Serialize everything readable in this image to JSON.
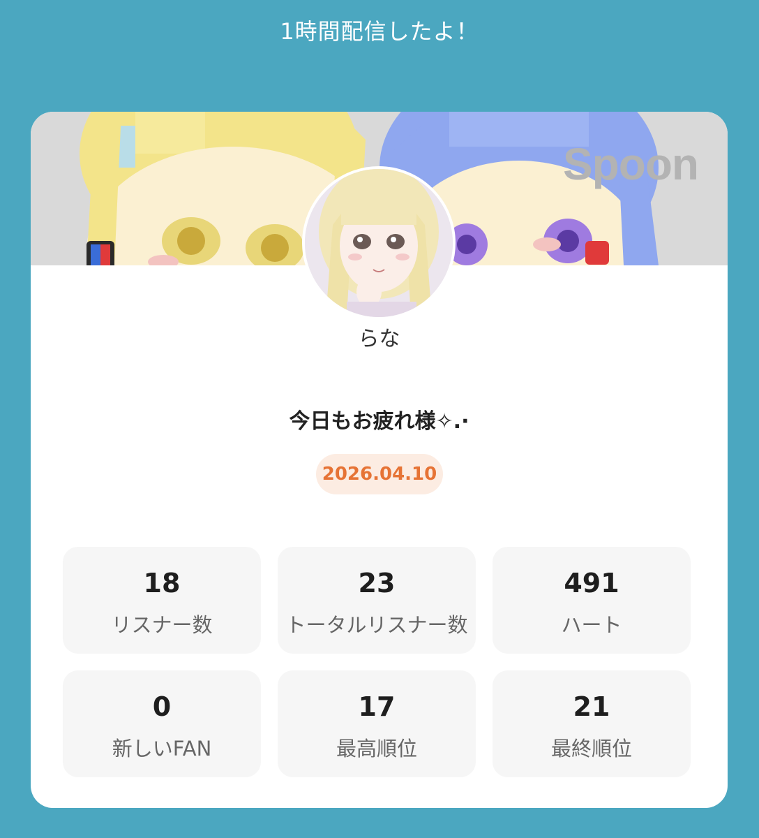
{
  "header": {
    "title": "1時間配信したよ！"
  },
  "card": {
    "banner": {
      "watermark": "Spoon"
    },
    "user": {
      "name": "らな",
      "avatar": "user-avatar"
    },
    "headline": "今日もお疲れ様✧.·",
    "date": "2026.04.10",
    "stats": [
      {
        "value": "18",
        "label": "リスナー数"
      },
      {
        "value": "23",
        "label": "トータルリスナー数"
      },
      {
        "value": "491",
        "label": "ハート"
      },
      {
        "value": "0",
        "label": "新しいFAN"
      },
      {
        "value": "17",
        "label": "最高順位"
      },
      {
        "value": "21",
        "label": "最終順位"
      }
    ]
  },
  "colors": {
    "background": "#4ba7c0",
    "card": "#ffffff",
    "date_text": "#e67335",
    "date_badge": "#fcece2",
    "stat_tile": "#f6f6f6"
  }
}
